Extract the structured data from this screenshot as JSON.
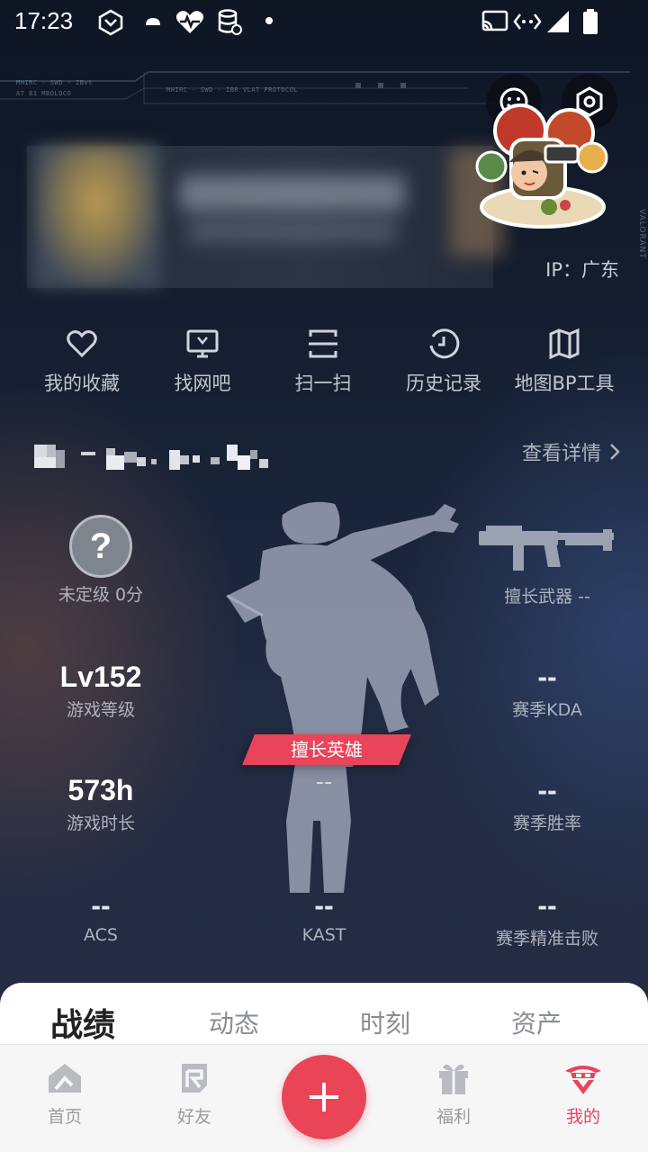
{
  "status_bar": {
    "time": "17:23"
  },
  "profile": {
    "ip_text": "IP：广东",
    "side_text": "VALORANT"
  },
  "circuit": {
    "text_1": "MHIRC - SWD - IBvt",
    "text_2": "AT B1 MBOLOCO",
    "text_3": "MHIRC - SWD - IBR VLAT PROTOCOL"
  },
  "actions": [
    {
      "label": "我的收藏",
      "icon": "heart-icon"
    },
    {
      "label": "找网吧",
      "icon": "monitor-icon"
    },
    {
      "label": "扫一扫",
      "icon": "scan-icon"
    },
    {
      "label": "历史记录",
      "icon": "history-icon"
    },
    {
      "label": "地图BP工具",
      "icon": "map-icon"
    }
  ],
  "account": {
    "details_label": "查看详情"
  },
  "stats": {
    "rank": {
      "value": "?",
      "label": "未定级 0分"
    },
    "weapon": {
      "label": "擅长武器 --"
    },
    "level": {
      "value": "Lv152",
      "label": "游戏等级"
    },
    "kda": {
      "value": "--",
      "label": "赛季KDA"
    },
    "hours": {
      "value": "573h",
      "label": "游戏时长"
    },
    "winrate": {
      "value": "--",
      "label": "赛季胜率"
    },
    "acs": {
      "value": "--",
      "label": "ACS"
    },
    "kast": {
      "value": "--",
      "label": "KAST"
    },
    "precise": {
      "value": "--",
      "label": "赛季精准击败"
    },
    "hero": {
      "tag": "擅长英雄",
      "value": "--"
    }
  },
  "tabs": [
    "战绩",
    "动态",
    "时刻",
    "资产"
  ],
  "bottom_nav": {
    "home": "首页",
    "friends": "好友",
    "benefits": "福利",
    "me": "我的"
  },
  "colors": {
    "accent": "#e8455a",
    "background": "#121a28"
  }
}
